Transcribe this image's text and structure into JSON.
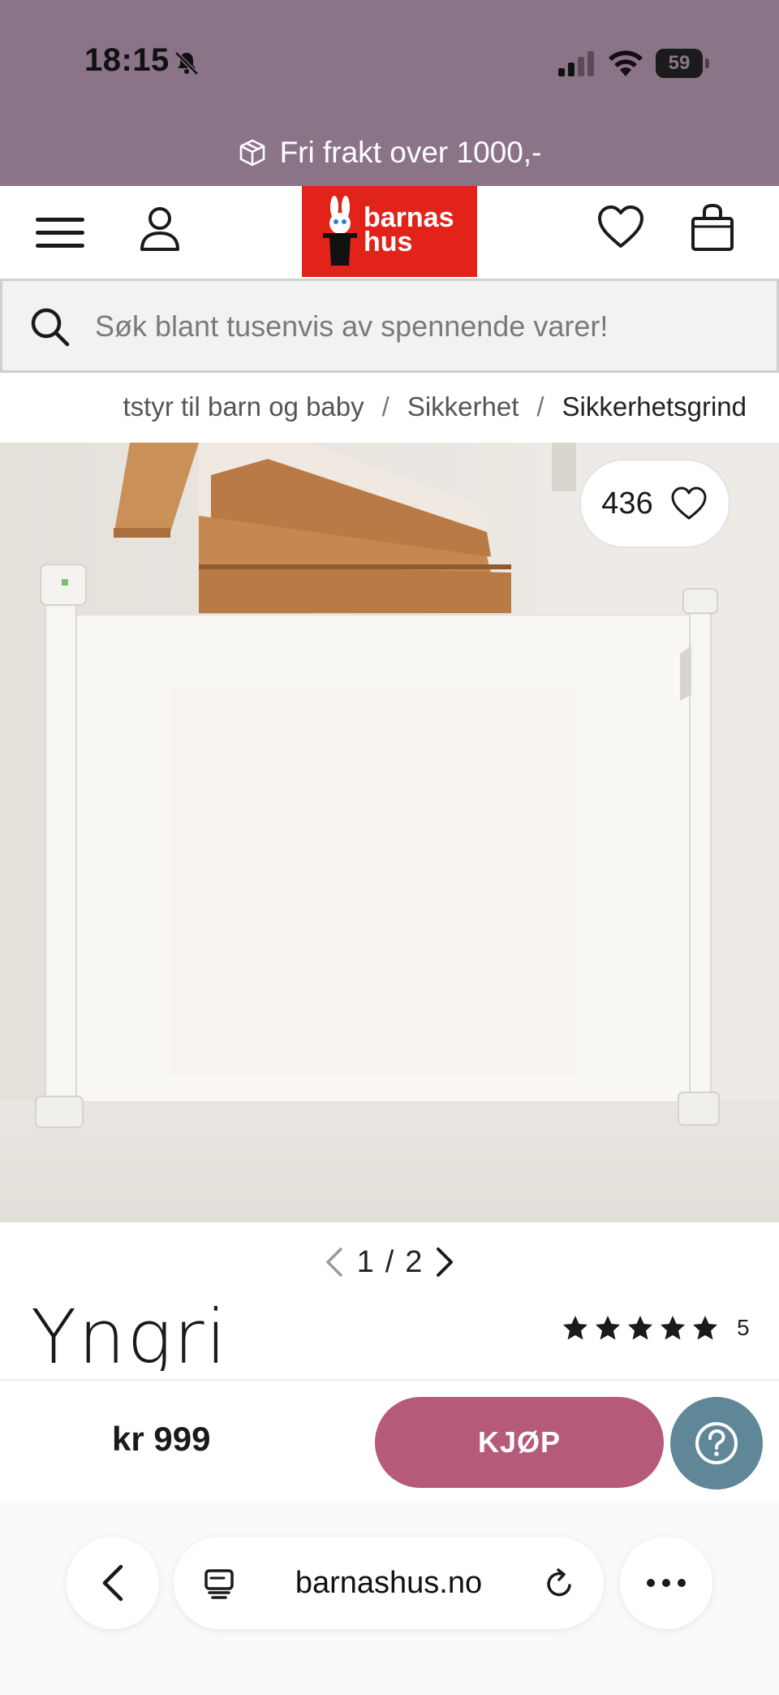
{
  "status_bar": {
    "time": "18:15",
    "battery_level": "59",
    "icons": [
      "bell-muted-icon",
      "cellular-signal-icon",
      "wifi-icon",
      "battery-icon"
    ]
  },
  "promo": {
    "text": "Fri frakt over 1000,-",
    "icon": "package-icon"
  },
  "header": {
    "logo_text_line1": "barnas",
    "logo_text_line2": "hus",
    "icons": [
      "menu-icon",
      "user-icon",
      "heart-icon",
      "shopping-bag-icon"
    ],
    "brand_color": "#e2231a"
  },
  "search": {
    "placeholder": "Søk blant tusenvis av spennende varer!"
  },
  "breadcrumb": {
    "items": [
      "tstyr til barn og baby",
      "Sikkerhet",
      "Sikkerhetsgrind"
    ],
    "separator": "/"
  },
  "product": {
    "likes": "436",
    "image_index": "1",
    "image_total": "2",
    "pager_separator": "/",
    "brand": "Yngri",
    "rating_stars": 5,
    "rating_count": "5",
    "price": "kr 999",
    "buy_label": "KJØP"
  },
  "colors": {
    "header_band": "#8b7488",
    "buy_button": "#b55a7b",
    "help_button": "#5f8797"
  },
  "browser": {
    "url": "barnashus.no",
    "icons": [
      "back-chevron-icon",
      "tab-icon",
      "reload-icon",
      "more-icon"
    ]
  }
}
